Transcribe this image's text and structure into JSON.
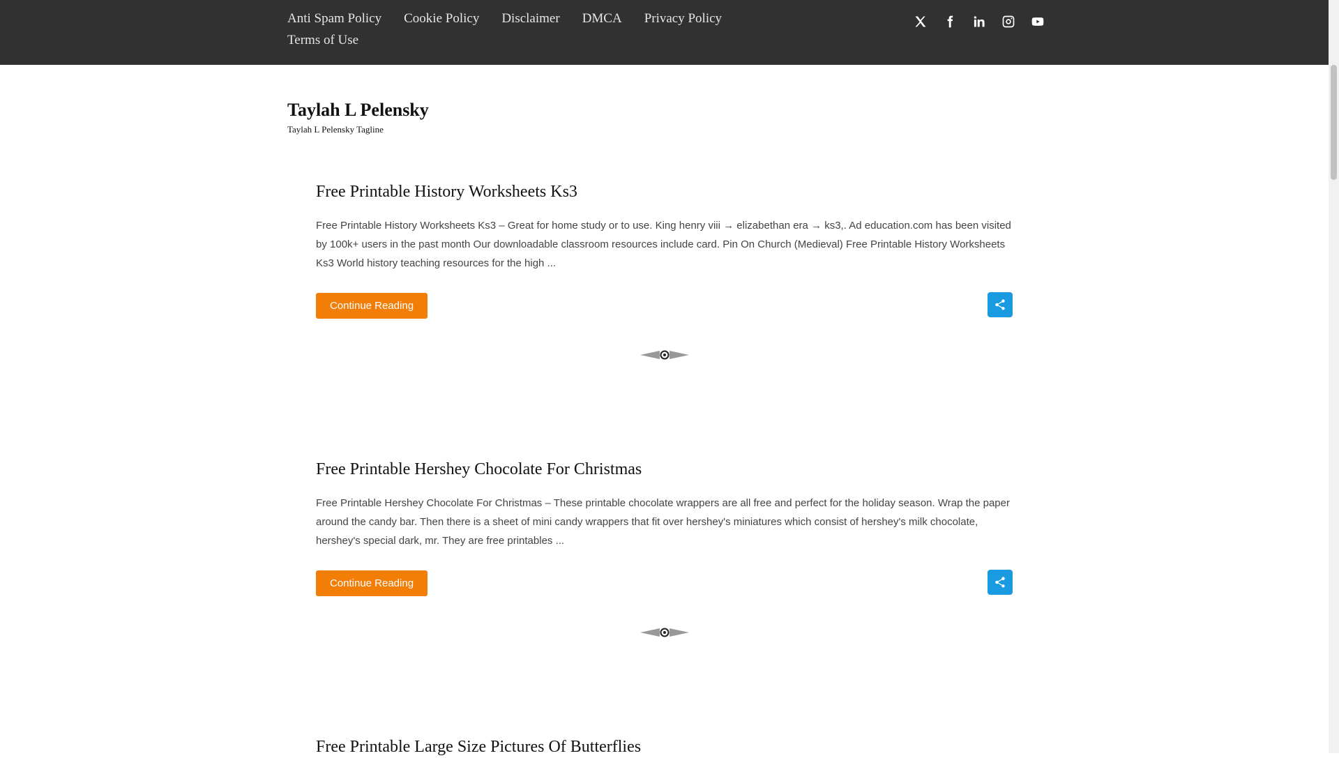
{
  "topnav": {
    "links": [
      "Anti Spam Policy",
      "Cookie Policy",
      "Disclaimer",
      "DMCA",
      "Privacy Policy",
      "Terms of Use"
    ]
  },
  "social": {
    "icons": [
      "x-icon",
      "facebook-icon",
      "linkedin-icon",
      "instagram-icon",
      "youtube-icon"
    ]
  },
  "site": {
    "title": "Taylah L Pelensky",
    "tagline": "Taylah L Pelensky Tagline"
  },
  "posts": [
    {
      "title": "Free Printable History Worksheets Ks3",
      "excerpt": "Free Printable History Worksheets Ks3 – Great for home study or to use. King henry viii → elizabethan era → ks3,. Ad education.com has been visited by 100k+ users in the past month Our downloadable classroom resources include card. Pin On Church (Medieval) Free Printable History Worksheets Ks3 World history teaching resources for the high ...",
      "button": "Continue Reading"
    },
    {
      "title": "Free Printable Hershey Chocolate For Christmas",
      "excerpt": "Free Printable Hershey Chocolate For Christmas – These printable chocolate wrappers are all free and perfect for the holiday season. Wrap the paper around the candy bar. Then there is a sheet of mini candy wrappers that fit over hershey's miniatures which consist of hershey's milk chocolate, hershey's special dark, mr. They are free printables ...",
      "button": "Continue Reading"
    },
    {
      "title": "Free Printable Large Size Pictures Of Butterflies"
    }
  ],
  "colors": {
    "topbar": "#313131",
    "button": "#f27e07",
    "share": "#1a9ae0"
  }
}
